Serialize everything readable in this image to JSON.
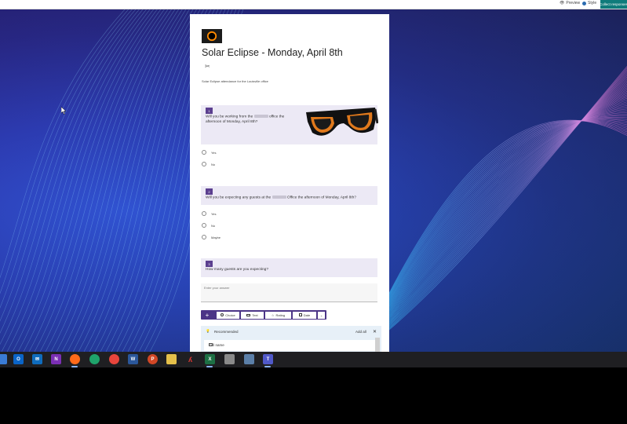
{
  "topbar": {
    "preview_label": "Preview",
    "style_label": "Style",
    "collect_label": "Collect responses"
  },
  "form": {
    "title": "Solar Eclipse - Monday, April 8th",
    "description": "Solar Eclipse attendance for the Louisville office",
    "questions": [
      {
        "number": "1",
        "text_a": "Will you be working from the",
        "text_b": "office the afternoon of Monday, April 8th?",
        "options": [
          "Yes",
          "No"
        ]
      },
      {
        "number": "2",
        "text_a": "Will you be expecting any guests at the",
        "text_b": "Office the afternoon of Monday, April 8th?",
        "options": [
          "Yes",
          "No",
          "Maybe"
        ]
      },
      {
        "number": "3",
        "text": "How many guests are you expecting?",
        "placeholder": "Enter your answer"
      }
    ],
    "add_bar": {
      "choice": "Choice",
      "text": "Text",
      "rating": "Rating",
      "date": "Date"
    },
    "recommended": {
      "title": "Recommended",
      "add_all": "Add all",
      "item": "Full name"
    }
  },
  "colors": {
    "accent": "#5b3f8f",
    "collect_button": "#0f7b7b",
    "question_bg": "#ece9f5",
    "taskbar": "#1f1f22"
  },
  "taskbar_icons": [
    "windows-menu",
    "outlook-icon",
    "onenote-icon",
    "firefox-icon",
    "edge-icon",
    "chrome-icon",
    "word-icon",
    "powerpoint-icon",
    "notes-icon",
    "acrobat-icon",
    "excel-icon",
    "printer-icon",
    "network-icon",
    "teams-icon"
  ]
}
